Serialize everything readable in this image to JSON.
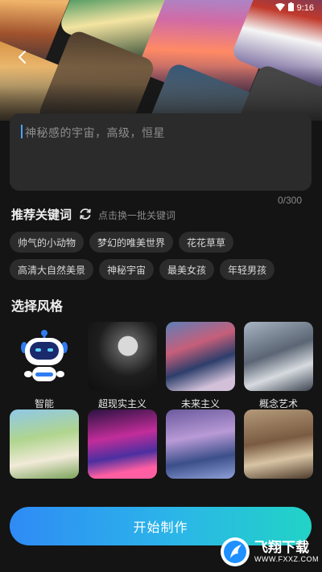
{
  "status": {
    "time": "9:16"
  },
  "prompt": {
    "placeholder": "神秘感的宇宙，高级，恒星",
    "counter": "0/300"
  },
  "keywords": {
    "title": "推荐关键词",
    "hint": "点击换一批关键词",
    "row1": [
      "帅气的小动物",
      "梦幻的唯美世界",
      "花花草草"
    ],
    "row2": [
      "高清大自然美景",
      "神秘宇宙",
      "最美女孩",
      "年轻男孩"
    ]
  },
  "styles": {
    "title": "选择风格",
    "items": [
      {
        "label": "智能"
      },
      {
        "label": "超现实主义"
      },
      {
        "label": "未来主义"
      },
      {
        "label": "概念艺术"
      }
    ]
  },
  "start_button": {
    "label": "开始制作"
  },
  "watermark": {
    "text": "飞翔下载",
    "sub": "WWW.FXXZ.COM"
  },
  "colors": {
    "accent_start": "#2f8bf5",
    "accent_end": "#22d3c6",
    "background": "#141414"
  }
}
